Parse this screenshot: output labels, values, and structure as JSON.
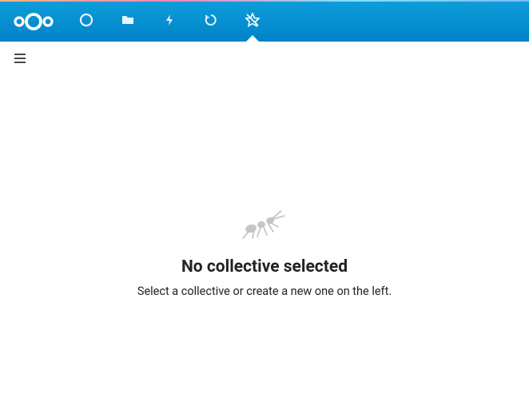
{
  "header": {
    "nav": [
      {
        "name": "dashboard",
        "active": false
      },
      {
        "name": "files",
        "active": false
      },
      {
        "name": "activity",
        "active": false
      },
      {
        "name": "updates",
        "active": false
      },
      {
        "name": "collectives",
        "active": true
      }
    ]
  },
  "empty_state": {
    "title": "No collective selected",
    "subtitle": "Select a collective or create a new one on the left."
  }
}
